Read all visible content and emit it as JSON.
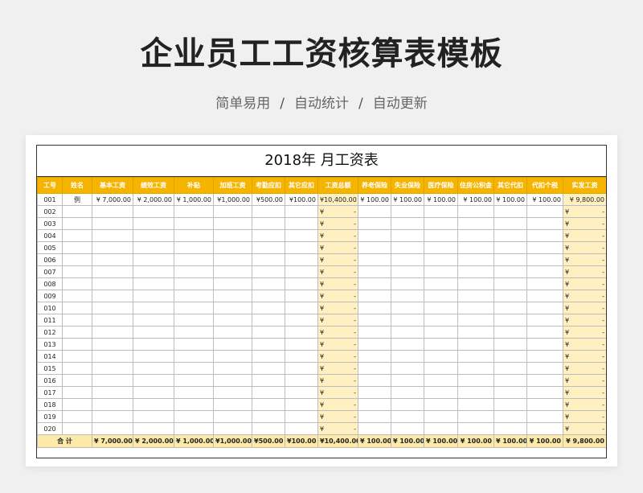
{
  "page": {
    "title": "企业员工工资核算表模板",
    "subtitle": [
      "简单易用",
      "自动统计",
      "自动更新"
    ],
    "separator": "/"
  },
  "sheet": {
    "title": "2018年  月工资表",
    "headers": [
      "工号",
      "姓名",
      "基本工资",
      "绩效工资",
      "补贴",
      "加班工资",
      "考勤应扣",
      "其它应扣",
      "工资总额",
      "养老保险",
      "失业保险",
      "医疗保险",
      "住房公积金",
      "其它代扣",
      "代扣个税",
      "实发工资"
    ],
    "example_row": [
      "001",
      "例",
      "¥ 7,000.00",
      "¥ 2,000.00",
      "¥ 1,000.00",
      "¥1,000.00",
      "¥500.00",
      "¥100.00",
      "¥10,400.00",
      "¥ 100.00",
      "¥ 100.00",
      "¥ 100.00",
      "¥ 100.00",
      "¥ 100.00",
      "¥ 100.00",
      "¥ 9,800.00"
    ],
    "ids": [
      "002",
      "003",
      "004",
      "005",
      "006",
      "007",
      "008",
      "009",
      "010",
      "011",
      "012",
      "013",
      "014",
      "015",
      "016",
      "017",
      "018",
      "019",
      "020"
    ],
    "currency_symbol": "¥",
    "empty_value": "-",
    "total_row": [
      "合 计",
      "¥ 7,000.00",
      "¥ 2,000.00",
      "¥ 1,000.00",
      "¥1,000.00",
      "¥500.00",
      "¥100.00",
      "¥10,400.00",
      "¥ 100.00",
      "¥ 100.00",
      "¥ 100.00",
      "¥ 100.00",
      "¥ 100.00",
      "¥ 100.00",
      "¥ 9,800.00"
    ]
  },
  "colors": {
    "header": "#f5b400",
    "highlight": "#fff0c2",
    "total": "#fde9a8"
  }
}
